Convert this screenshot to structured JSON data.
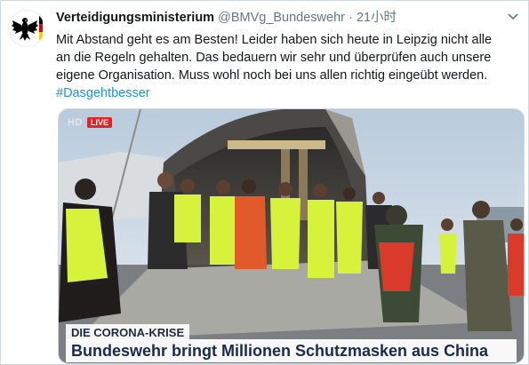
{
  "tweet": {
    "display_name": "Verteidigungsministerium",
    "handle": "@BMVg_Bundeswehr",
    "separator": "·",
    "timestamp": "21小时",
    "lines": [
      "Mit Abstand geht es am Besten! Leider haben sich heute in Leipzig nicht alle",
      "an die Regeln gehalten. Das bedauern wir sehr und überprüfen auch unsere",
      "eigene Organisation. Muss wohl noch bei uns allen richtig eingeübt werden."
    ],
    "hashtag": "#Dasgehtbesser"
  },
  "video": {
    "hd_label": "HD",
    "live_label": "LIVE",
    "topic": "DIE CORONA-KRISE",
    "headline": "Bundeswehr bringt Millionen Schutzmasken aus China"
  },
  "colors": {
    "link": "#1b95e0",
    "text": "#14171a",
    "muted": "#657786",
    "live": "#e0242a",
    "vest": "#d7f23a"
  }
}
